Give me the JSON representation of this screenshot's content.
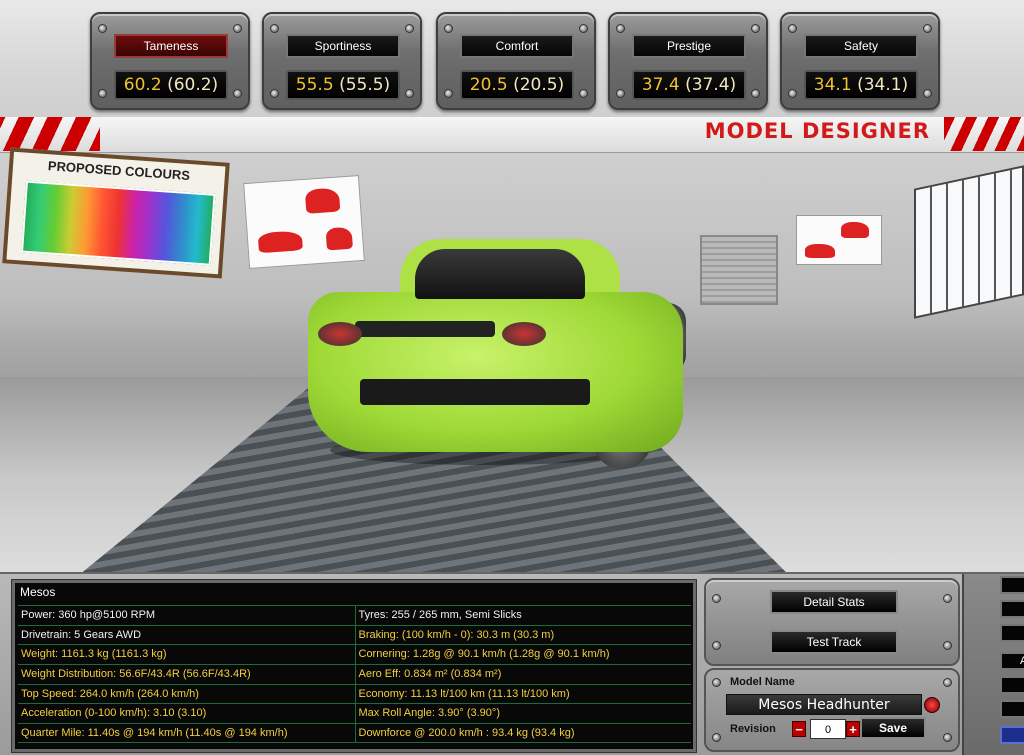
{
  "stats_bar": [
    {
      "label": "Tameness",
      "value": "60.2",
      "paren": "(60.2)",
      "active": true
    },
    {
      "label": "Sportiness",
      "value": "55.5",
      "paren": "(55.5)",
      "active": false
    },
    {
      "label": "Comfort",
      "value": "20.5",
      "paren": "(20.5)",
      "active": false
    },
    {
      "label": "Prestige",
      "value": "37.4",
      "paren": "(37.4)",
      "active": false
    },
    {
      "label": "Safety",
      "value": "34.1",
      "paren": "(34.1)",
      "active": false
    }
  ],
  "scene": {
    "title": "MODEL DESIGNER",
    "board_title": "PROPOSED COLOURS",
    "car_color": "#9ed936"
  },
  "stats_panel": {
    "header": "Mesos",
    "rows": [
      [
        {
          "text": "Power: 360 hp@5100 RPM",
          "style": "w"
        },
        {
          "text": "Tyres: 255 / 265 mm, Semi Slicks",
          "style": "w"
        }
      ],
      [
        {
          "text": "Drivetrain: 5 Gears AWD",
          "style": "w"
        },
        {
          "text": "Braking: (100 km/h - 0): 30.3 m (30.3 m)",
          "style": "y"
        }
      ],
      [
        {
          "text": "Weight: 1161.3 kg (1161.3 kg)",
          "style": "y"
        },
        {
          "text": "Cornering: 1.28g @ 90.1 km/h (1.28g @ 90.1 km/h)",
          "style": "y"
        }
      ],
      [
        {
          "text": "Weight Distribution: 56.6F/43.4R (56.6F/43.4R)",
          "style": "y"
        },
        {
          "text": "Aero Eff: 0.834 m² (0.834 m²)",
          "style": "y"
        }
      ],
      [
        {
          "text": "Top Speed: 264.0 km/h (264.0 km/h)",
          "style": "y"
        },
        {
          "text": "Economy: 11.13 lt/100 km (11.13 lt/100 km)",
          "style": "y"
        }
      ],
      [
        {
          "text": "Acceleration (0-100 km/h): 3.10 (3.10)",
          "style": "y"
        },
        {
          "text": "Max Roll Angle: 3.90° (3.90°)",
          "style": "y"
        }
      ],
      [
        {
          "text": "Quarter Mile: 11.40s @ 194 km/h (11.40s @ 194 km/h)",
          "style": "y"
        },
        {
          "text": "Downforce @ 200.0 km/h : 93.4 kg (93.4 kg)",
          "style": "y"
        }
      ]
    ]
  },
  "buttons": {
    "detail_stats": "Detail Stats",
    "test_track": "Test Track",
    "save": "Save"
  },
  "model": {
    "name_label": "Model Name",
    "name_value": "Mesos Headhunter",
    "revision_label": "Revision",
    "revision_value": "0",
    "minus": "−",
    "plus": "+"
  },
  "side": {
    "partial_label": "A"
  }
}
